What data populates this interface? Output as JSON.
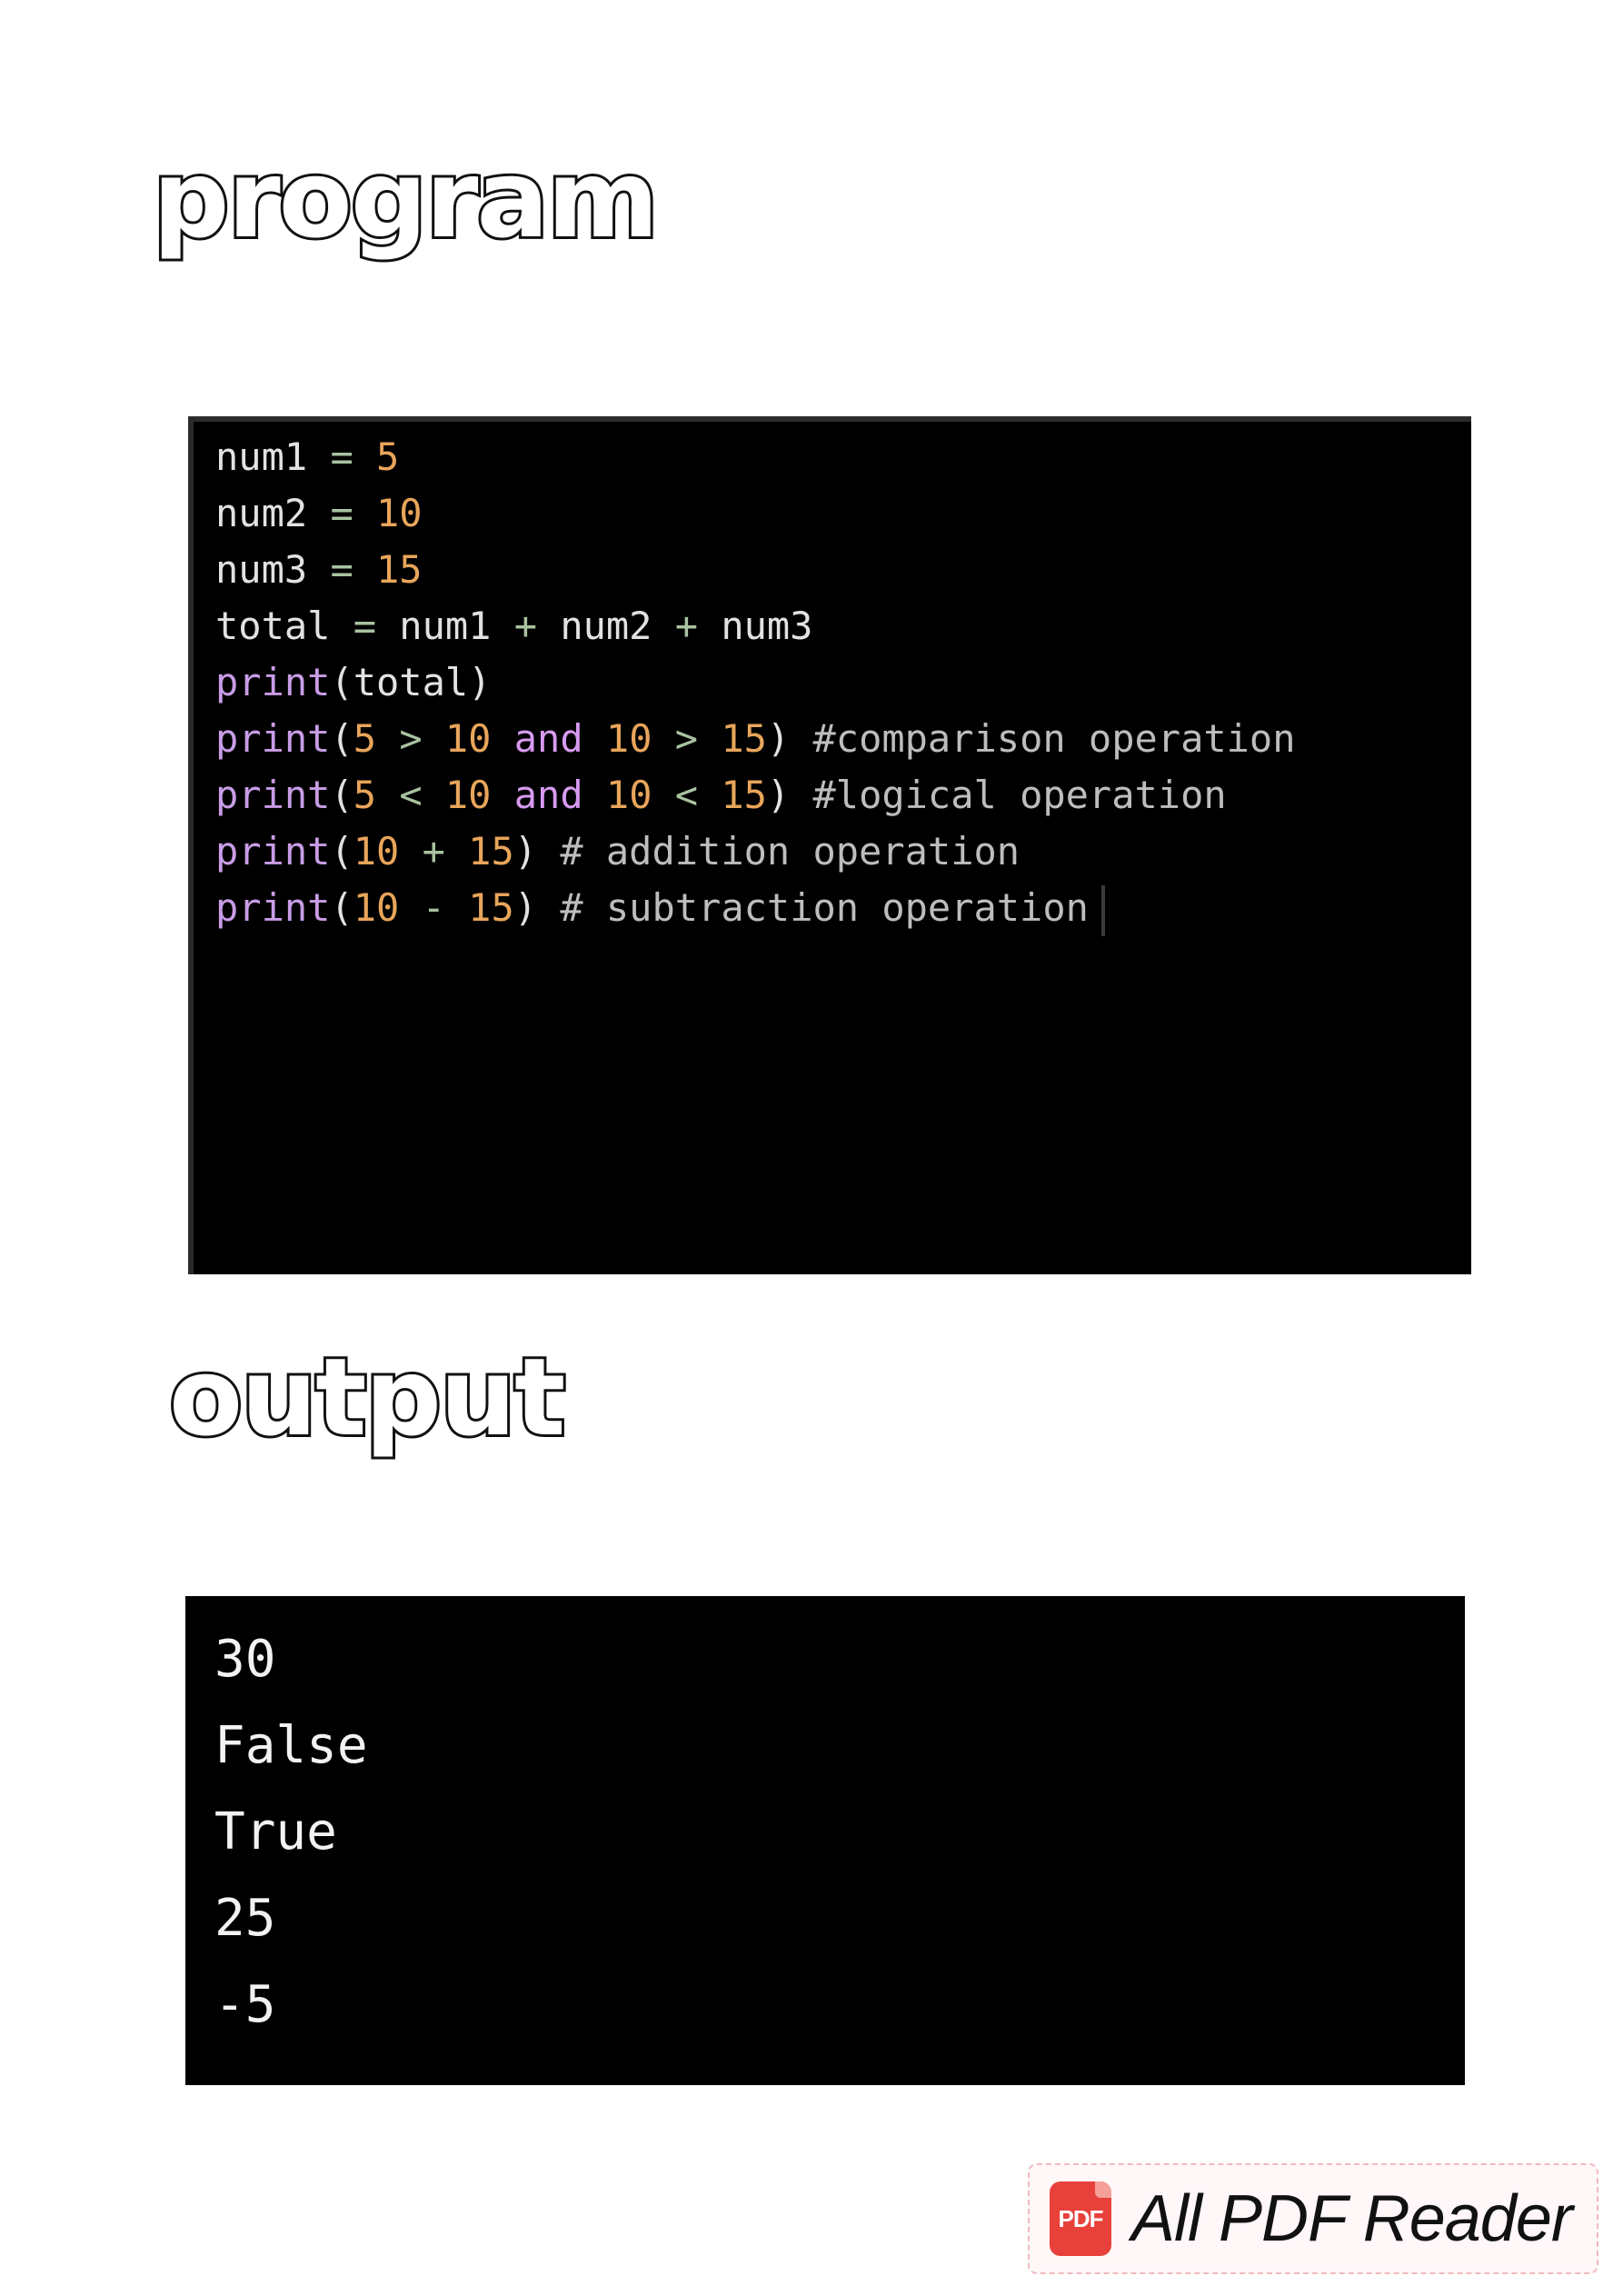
{
  "program_heading": "program",
  "output_heading": "output",
  "code": {
    "lines": [
      [
        {
          "t": "num1 ",
          "c": "plain"
        },
        {
          "t": "= ",
          "c": "op"
        },
        {
          "t": "5",
          "c": "num"
        }
      ],
      [
        {
          "t": "num2 ",
          "c": "plain"
        },
        {
          "t": "= ",
          "c": "op"
        },
        {
          "t": "10",
          "c": "num"
        }
      ],
      [
        {
          "t": "num3 ",
          "c": "plain"
        },
        {
          "t": "= ",
          "c": "op"
        },
        {
          "t": "15",
          "c": "num"
        }
      ],
      [
        {
          "t": "total ",
          "c": "plain"
        },
        {
          "t": "= ",
          "c": "op"
        },
        {
          "t": "num1 ",
          "c": "plain"
        },
        {
          "t": "+ ",
          "c": "op"
        },
        {
          "t": "num2 ",
          "c": "plain"
        },
        {
          "t": "+ ",
          "c": "op"
        },
        {
          "t": "num3",
          "c": "plain"
        }
      ],
      [
        {
          "t": "print",
          "c": "func"
        },
        {
          "t": "(total)",
          "c": "plain"
        }
      ],
      [
        {
          "t": "print",
          "c": "func"
        },
        {
          "t": "(",
          "c": "plain"
        },
        {
          "t": "5 ",
          "c": "num"
        },
        {
          "t": "> ",
          "c": "op"
        },
        {
          "t": "10 ",
          "c": "num"
        },
        {
          "t": "and ",
          "c": "kw"
        },
        {
          "t": "10 ",
          "c": "num"
        },
        {
          "t": "> ",
          "c": "op"
        },
        {
          "t": "15",
          "c": "num"
        },
        {
          "t": ") ",
          "c": "plain"
        },
        {
          "t": "#comparison operation",
          "c": "comment"
        }
      ],
      [
        {
          "t": "print",
          "c": "func"
        },
        {
          "t": "(",
          "c": "plain"
        },
        {
          "t": "5 ",
          "c": "num"
        },
        {
          "t": "< ",
          "c": "op"
        },
        {
          "t": "10 ",
          "c": "num"
        },
        {
          "t": "and ",
          "c": "kw"
        },
        {
          "t": "10 ",
          "c": "num"
        },
        {
          "t": "< ",
          "c": "op"
        },
        {
          "t": "15",
          "c": "num"
        },
        {
          "t": ") ",
          "c": "plain"
        },
        {
          "t": "#logical operation",
          "c": "comment"
        }
      ],
      [
        {
          "t": "print",
          "c": "func"
        },
        {
          "t": "(",
          "c": "plain"
        },
        {
          "t": "10 ",
          "c": "num"
        },
        {
          "t": "+ ",
          "c": "op"
        },
        {
          "t": "15",
          "c": "num"
        },
        {
          "t": ") ",
          "c": "plain"
        },
        {
          "t": "# addition operation",
          "c": "comment"
        }
      ],
      [
        {
          "t": "print",
          "c": "func"
        },
        {
          "t": "(",
          "c": "plain"
        },
        {
          "t": "10 ",
          "c": "num"
        },
        {
          "t": "- ",
          "c": "op"
        },
        {
          "t": "15",
          "c": "num"
        },
        {
          "t": ") ",
          "c": "plain"
        },
        {
          "t": "# subtraction operation",
          "c": "comment"
        }
      ]
    ]
  },
  "output": {
    "lines": [
      "30",
      "False",
      "True",
      "25",
      "-5"
    ]
  },
  "badge": {
    "icon_text": "PDF",
    "label": "All PDF Reader"
  },
  "colors": {
    "background": "#ffffff",
    "panel": "#000000",
    "number": "#e8a55a",
    "function": "#c99ce6",
    "keyword": "#d79af0",
    "operator": "#a9c3a0",
    "pdf_icon": "#e8403a"
  }
}
